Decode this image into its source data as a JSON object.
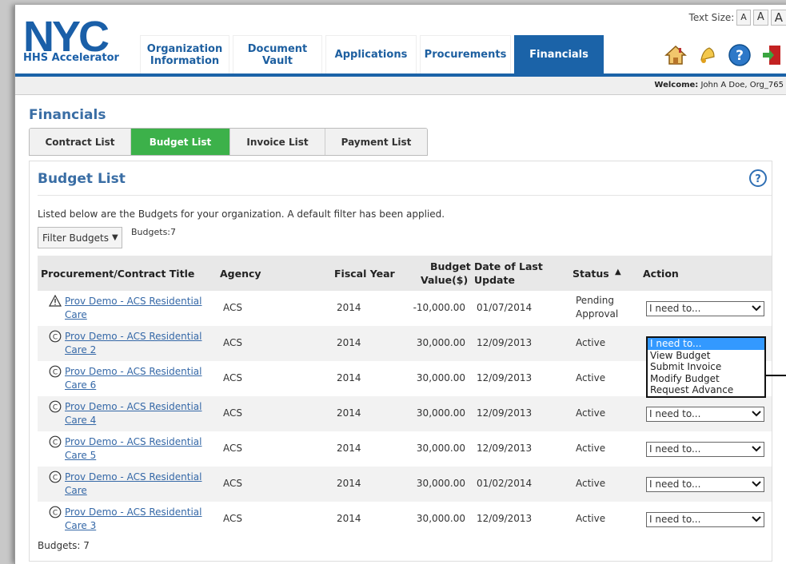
{
  "header": {
    "logo_text": "NYC",
    "logo_subtitle": "HHS Accelerator",
    "text_size_label": "Text Size:",
    "text_size_options": [
      "A",
      "A",
      "A"
    ],
    "nav_tabs": [
      {
        "label": "Organization\nInformation"
      },
      {
        "label": "Document\nVault"
      },
      {
        "label": "Applications"
      },
      {
        "label": "Procurements"
      },
      {
        "label": "Financials",
        "active": true
      }
    ],
    "icons": [
      "home-icon",
      "alert-bell-icon",
      "help-icon",
      "logout-icon"
    ],
    "welcome_label": "Welcome:",
    "welcome_user": "John A Doe, Org_765"
  },
  "page": {
    "title": "Financials",
    "subtabs": [
      {
        "label": "Contract List"
      },
      {
        "label": "Budget List",
        "active": true
      },
      {
        "label": "Invoice List"
      },
      {
        "label": "Payment List"
      }
    ]
  },
  "budget_list": {
    "title": "Budget List",
    "intro": "Listed below are the Budgets for your organization. A default filter has been applied.",
    "filter_label": "Filter Budgets",
    "count_top": "Budgets:7",
    "count_bottom": "Budgets: 7",
    "columns": {
      "title": "Procurement/Contract Title",
      "agency": "Agency",
      "fiscal_year": "Fiscal Year",
      "budget_value_1": "Budget",
      "budget_value_2": "Value($)",
      "date_1": "Date of Last",
      "date_2": "Update",
      "status": "Status",
      "status_sort": "▲",
      "action": "Action"
    },
    "action_default": "I need to...",
    "dropdown_options": [
      "I need to...",
      "View Budget",
      "Submit Invoice",
      "Modify Budget",
      "Request Advance"
    ],
    "rows": [
      {
        "symbol": "warning",
        "title_1": "Prov Demo - ACS Residential",
        "title_2": "Care",
        "agency": "ACS",
        "fy": "2014",
        "value": "-10,000.00",
        "date": "01/07/2014",
        "status_1": "Pending",
        "status_2": "Approval"
      },
      {
        "symbol": "copyright",
        "title_1": "Prov Demo - ACS Residential",
        "title_2": "Care 2",
        "agency": "ACS",
        "fy": "2014",
        "value": "30,000.00",
        "date": "12/09/2013",
        "status_1": "Active",
        "status_2": ""
      },
      {
        "symbol": "copyright",
        "title_1": "Prov Demo - ACS Residential",
        "title_2": "Care 6",
        "agency": "ACS",
        "fy": "2014",
        "value": "30,000.00",
        "date": "12/09/2013",
        "status_1": "Active",
        "status_2": ""
      },
      {
        "symbol": "copyright",
        "title_1": "Prov Demo - ACS Residential",
        "title_2": "Care 4",
        "agency": "ACS",
        "fy": "2014",
        "value": "30,000.00",
        "date": "12/09/2013",
        "status_1": "Active",
        "status_2": ""
      },
      {
        "symbol": "copyright",
        "title_1": "Prov Demo - ACS Residential",
        "title_2": "Care 5",
        "agency": "ACS",
        "fy": "2014",
        "value": "30,000.00",
        "date": "12/09/2013",
        "status_1": "Active",
        "status_2": ""
      },
      {
        "symbol": "copyright",
        "title_1": "Prov Demo - ACS Residential",
        "title_2": "Care",
        "agency": "ACS",
        "fy": "2014",
        "value": "30,000.00",
        "date": "01/02/2014",
        "status_1": "Active",
        "status_2": ""
      },
      {
        "symbol": "copyright",
        "title_1": "Prov Demo - ACS Residential",
        "title_2": "Care 3",
        "agency": "ACS",
        "fy": "2014",
        "value": "30,000.00",
        "date": "12/09/2013",
        "status_1": "Active",
        "status_2": ""
      }
    ]
  },
  "colors": {
    "brand_blue": "#1b63a8",
    "active_green": "#3cb14a",
    "link": "#3568a7",
    "selected": "#3399ff"
  }
}
